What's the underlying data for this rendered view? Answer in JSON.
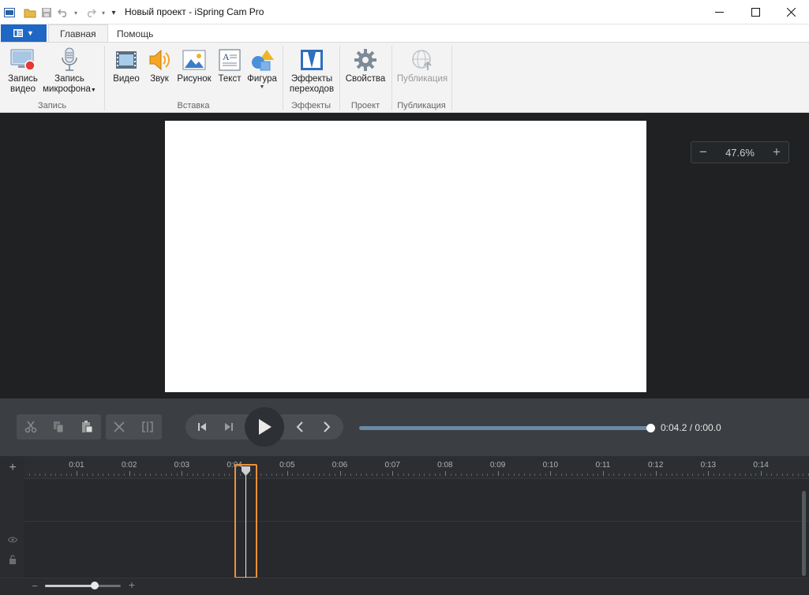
{
  "window": {
    "title": "Новый проект - iSpring Cam Pro"
  },
  "tabs": {
    "home": "Главная",
    "help": "Помощь"
  },
  "ribbon": {
    "record_video": "Запись\nвидео",
    "record_video_l1": "Запись",
    "record_video_l2": "видео",
    "record_mic_l1": "Запись",
    "record_mic_l2": "микрофона",
    "video": "Видео",
    "sound": "Звук",
    "picture": "Рисунок",
    "text": "Текст",
    "shape": "Фигура",
    "transitions_l1": "Эффекты",
    "transitions_l2": "переходов",
    "properties": "Свойства",
    "publish": "Публикация",
    "groups": {
      "record": "Запись",
      "insert": "Вставка",
      "effects": "Эффекты",
      "project": "Проект",
      "publish": "Публикация"
    }
  },
  "stage": {
    "zoom_value": "47.6%",
    "zoom_minus": "−",
    "zoom_plus": "+"
  },
  "player": {
    "time": "0:04.2 / 0:00.0",
    "progress_fraction": 1.0
  },
  "timeline": {
    "add_symbol": "+",
    "ticks": [
      "0:01",
      "0:02",
      "0:03",
      "0:04",
      "0:05",
      "0:06",
      "0:07",
      "0:08",
      "0:09",
      "0:10",
      "0:11",
      "0:12",
      "0:13",
      "0:14"
    ],
    "zoom_minus": "−",
    "zoom_plus": "+"
  },
  "colors": {
    "accent_blue": "#1f67c4",
    "playhead_highlight": "#f0903a",
    "stage_bg": "#1f2123",
    "progress_fill": "#6a8aa3"
  }
}
